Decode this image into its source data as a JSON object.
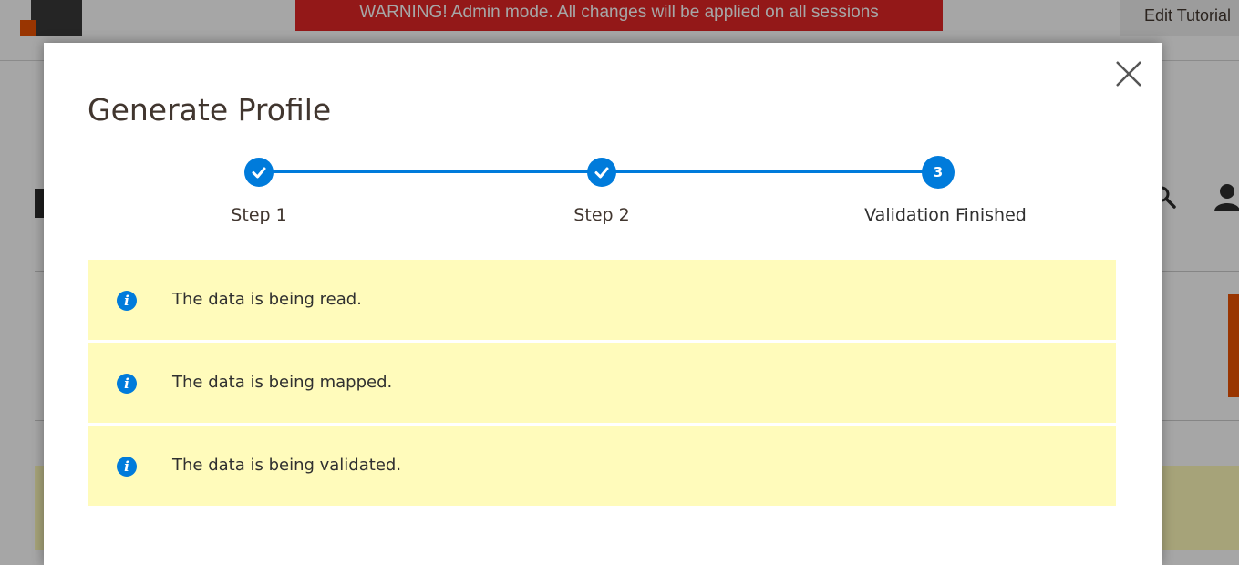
{
  "background": {
    "warning_banner": "WARNING! Admin mode. All changes will be applied on all sessions",
    "edit_button": "Edit Tutorial"
  },
  "modal": {
    "title": "Generate Profile",
    "steps": [
      {
        "label": "Step 1",
        "status": "complete",
        "icon": "check-icon"
      },
      {
        "label": "Step 2",
        "status": "complete",
        "icon": "check-icon"
      },
      {
        "label": "Validation Finished",
        "status": "current",
        "number": "3"
      }
    ],
    "messages": [
      {
        "icon": "info-icon",
        "text": "The data is being read."
      },
      {
        "icon": "info-icon",
        "text": "The data is being mapped."
      },
      {
        "icon": "info-icon",
        "text": "The data is being validated."
      }
    ]
  },
  "colors": {
    "accent": "#007bdb",
    "message_background": "#fffbbb",
    "warning": "#e22626",
    "brand_orange": "#eb5202",
    "title_text": "#41362f"
  }
}
